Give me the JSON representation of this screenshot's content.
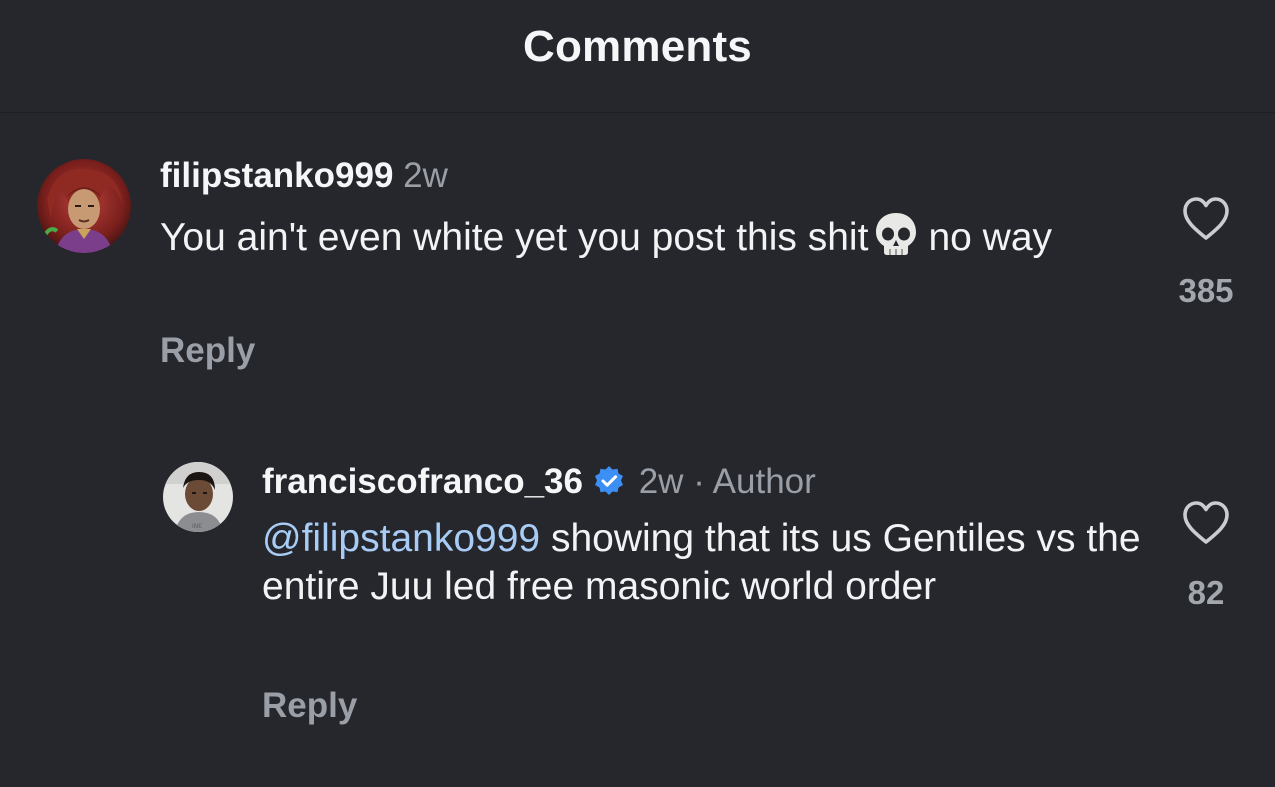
{
  "header": {
    "title": "Comments"
  },
  "comments": [
    {
      "username": "filipstanko999",
      "time": "2w",
      "text_before_emoji": "You ain't even white yet you post this shit",
      "emoji": "skull-emoji",
      "text_after_emoji": "no way",
      "reply_label": "Reply",
      "like_count": "385",
      "like_icon": "heart-outline-icon"
    },
    {
      "username": "franciscofranco_36",
      "verified": true,
      "time": "2w",
      "separator": "·",
      "author_tag": "Author",
      "mention": "@filipstanko999",
      "text": "showing that its us Gentiles vs the entire Juu led free masonic world order",
      "reply_label": "Reply",
      "like_count": "82",
      "like_icon": "heart-outline-icon"
    }
  ],
  "colors": {
    "background": "#25272c",
    "text_primary": "#f2f3f5",
    "text_secondary": "#9a9ea6",
    "mention": "#a8ccf5",
    "verified_badge": "#3b8ff5"
  }
}
